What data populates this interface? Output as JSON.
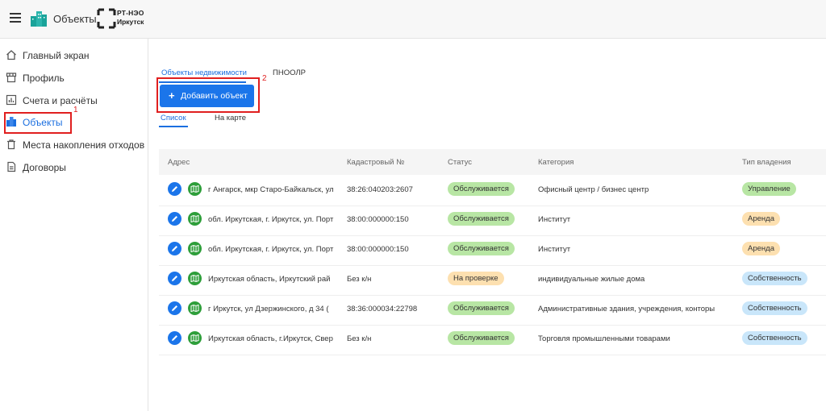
{
  "header": {
    "title": "Объекты",
    "logo_line1": "РТ-НЭО",
    "logo_line2": "Иркутск"
  },
  "sidebar": {
    "items": [
      {
        "label": "Главный экран",
        "icon": "home-icon"
      },
      {
        "label": "Профиль",
        "icon": "store-icon"
      },
      {
        "label": "Счета и расчёты",
        "icon": "chart-icon"
      },
      {
        "label": "Объекты",
        "icon": "buildings-icon",
        "active": true
      },
      {
        "label": "Места накопления отходов",
        "icon": "trash-icon"
      },
      {
        "label": "Договоры",
        "icon": "document-icon"
      }
    ]
  },
  "annotations": {
    "num1": "1",
    "num2": "2",
    "color": "#e01f1f"
  },
  "tabs": [
    "Объекты недвижимости",
    "ПНООЛР"
  ],
  "add_button": "Добавить объект",
  "view_tabs": [
    "Список",
    "На карте"
  ],
  "table": {
    "headers": [
      "Адрес",
      "Кадастровый №",
      "Статус",
      "Категория",
      "Тип владения"
    ],
    "rows": [
      {
        "address": "г Ангарск, мкр Старо-Байкальск, ул",
        "cadastral": "38:26:040203:2607",
        "status": "Обслуживается",
        "status_type": "green",
        "category": "Офисный центр / бизнес центр",
        "ownership": "Управление",
        "ownership_type": "green"
      },
      {
        "address": "обл. Иркутская, г. Иркутск, ул. Порт",
        "cadastral": "38:00:000000:150",
        "status": "Обслуживается",
        "status_type": "green",
        "category": "Институт",
        "ownership": "Аренда",
        "ownership_type": "orange"
      },
      {
        "address": "обл. Иркутская, г. Иркутск, ул. Порт",
        "cadastral": "38:00:000000:150",
        "status": "Обслуживается",
        "status_type": "green",
        "category": "Институт",
        "ownership": "Аренда",
        "ownership_type": "orange"
      },
      {
        "address": "Иркутская область, Иркутский рай",
        "cadastral": "Без к/н",
        "status": "На проверке",
        "status_type": "orange",
        "category": "индивидуальные жилые дома",
        "ownership": "Собственность",
        "ownership_type": "blue"
      },
      {
        "address": "г Иркутск, ул Дзержинского, д 34 (",
        "cadastral": "38:36:000034:22798",
        "status": "Обслуживается",
        "status_type": "green",
        "category": "Административные здания, учреждения, конторы",
        "ownership": "Собственность",
        "ownership_type": "blue"
      },
      {
        "address": "Иркутская область, г.Иркутск, Свер",
        "cadastral": "Без к/н",
        "status": "Обслуживается",
        "status_type": "green",
        "category": "Торговля промышленными товарами",
        "ownership": "Собственность",
        "ownership_type": "blue"
      }
    ]
  },
  "colors": {
    "accent": "#1b75ea",
    "green_badge": "#b8e6a4",
    "orange_badge": "#fde0b0",
    "blue_badge": "#c9e6fa"
  }
}
